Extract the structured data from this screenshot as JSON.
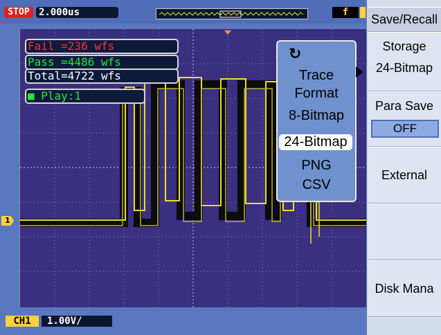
{
  "status": {
    "run_state": "STOP",
    "timebase": "2.000us",
    "trigger_symbol": "f"
  },
  "measure": {
    "fail": "Fail =236 wfs",
    "pass": "Pass =4486 wfs",
    "total": "Total=4722 wfs",
    "play": "Play:1"
  },
  "channel": {
    "marker": "1",
    "badge": "CH1",
    "scale": "1.00V/"
  },
  "popup": {
    "icon": "rotate-knob-icon",
    "title1": "Trace",
    "title2": "Format",
    "options": [
      "8-Bitmap",
      "24-Bitmap",
      "PNG",
      "CSV"
    ],
    "selected": "24-Bitmap"
  },
  "sidebar": {
    "save_recall": "Save/Recall",
    "storage_label": "Storage",
    "storage_value": "24-Bitmap",
    "para_save_label": "Para Save",
    "para_save_value": "OFF",
    "external": "External",
    "disk_manager": "Disk Mana"
  },
  "colors": {
    "trace": "#e8e020",
    "background": "#3b2f80",
    "fail": "#ff3030",
    "pass": "#26e83a"
  }
}
